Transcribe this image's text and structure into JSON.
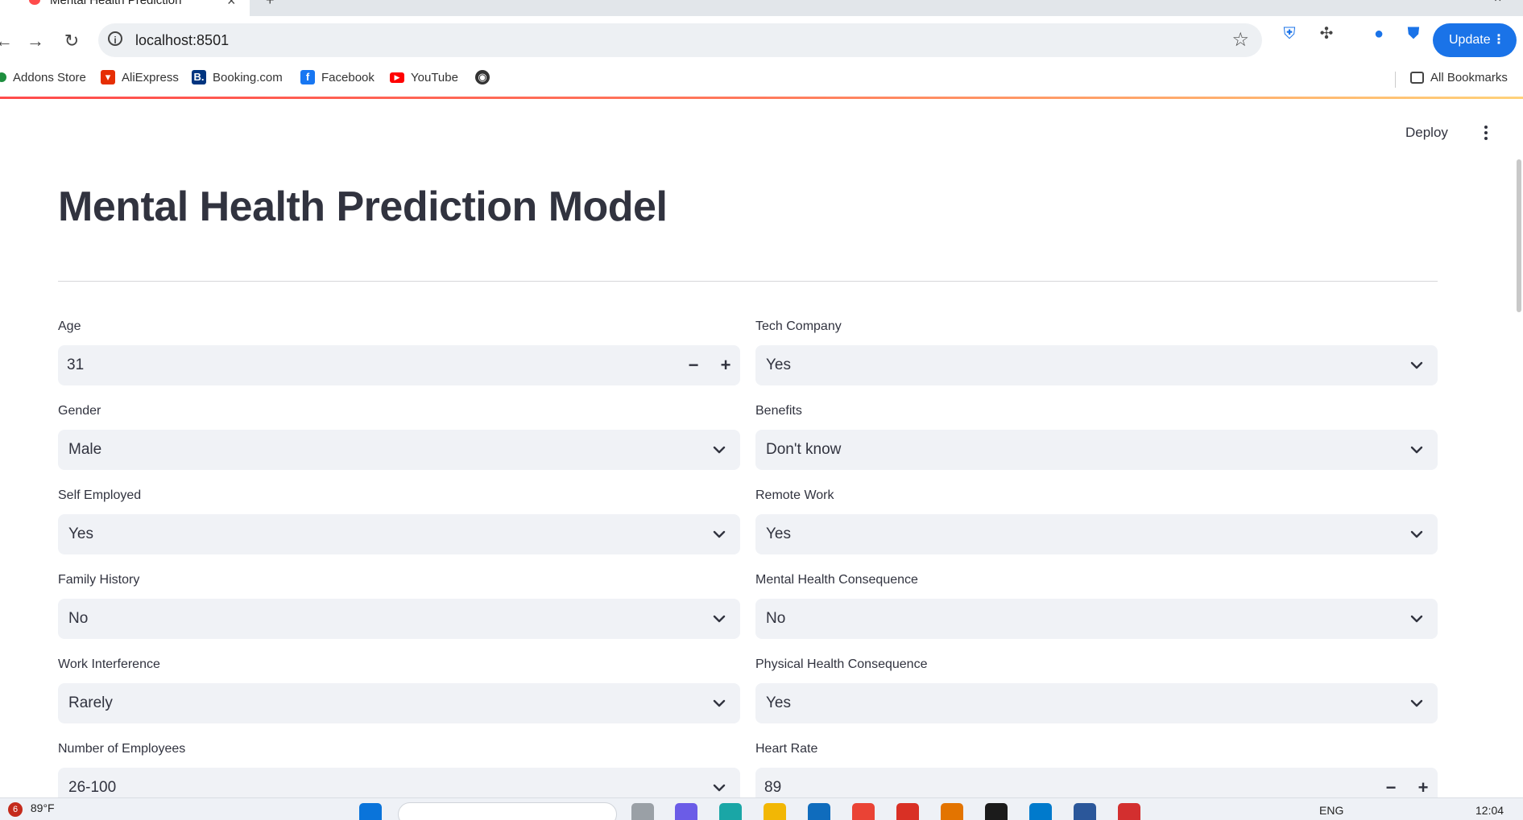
{
  "browser": {
    "tab_title": "Mental Health Prediction",
    "url": "localhost:8501",
    "update_label": "Update",
    "bookmarks": [
      {
        "label": "Addons Store",
        "icon": "addons-icon",
        "color": "#1e8e3e"
      },
      {
        "label": "AliExpress",
        "icon": "aliexpress-icon",
        "color": "#e62e04"
      },
      {
        "label": "Booking.com",
        "icon": "booking-icon",
        "color": "#003580"
      },
      {
        "label": "Facebook",
        "icon": "facebook-icon",
        "color": "#1877f2"
      },
      {
        "label": "YouTube",
        "icon": "youtube-icon",
        "color": "#ff0000"
      }
    ],
    "all_bookmarks": "All Bookmarks"
  },
  "app": {
    "deploy_label": "Deploy",
    "title": "Mental Health Prediction Model",
    "fields": {
      "age": {
        "label": "Age",
        "value": "31"
      },
      "tech_company": {
        "label": "Tech Company",
        "value": "Yes"
      },
      "gender": {
        "label": "Gender",
        "value": "Male"
      },
      "benefits": {
        "label": "Benefits",
        "value": "Don't know"
      },
      "self_employed": {
        "label": "Self Employed",
        "value": "Yes"
      },
      "remote_work": {
        "label": "Remote Work",
        "value": "Yes"
      },
      "family_history": {
        "label": "Family History",
        "value": "No"
      },
      "mh_consequence": {
        "label": "Mental Health Consequence",
        "value": "No"
      },
      "work_interference": {
        "label": "Work Interference",
        "value": "Rarely"
      },
      "ph_consequence": {
        "label": "Physical Health Consequence",
        "value": "Yes"
      },
      "num_employees": {
        "label": "Number of Employees",
        "value": "26-100"
      },
      "heart_rate": {
        "label": "Heart Rate",
        "value": "89"
      }
    },
    "stepper": {
      "minus": "−",
      "plus": "+"
    }
  },
  "taskbar": {
    "notification_count": "6",
    "temperature": "89°F",
    "language": "ENG",
    "time": "12:04"
  },
  "colors": {
    "accent": "#ff4b4b",
    "input_bg": "#f0f2f6",
    "update_button": "#1a73e8",
    "text": "#31333f"
  }
}
